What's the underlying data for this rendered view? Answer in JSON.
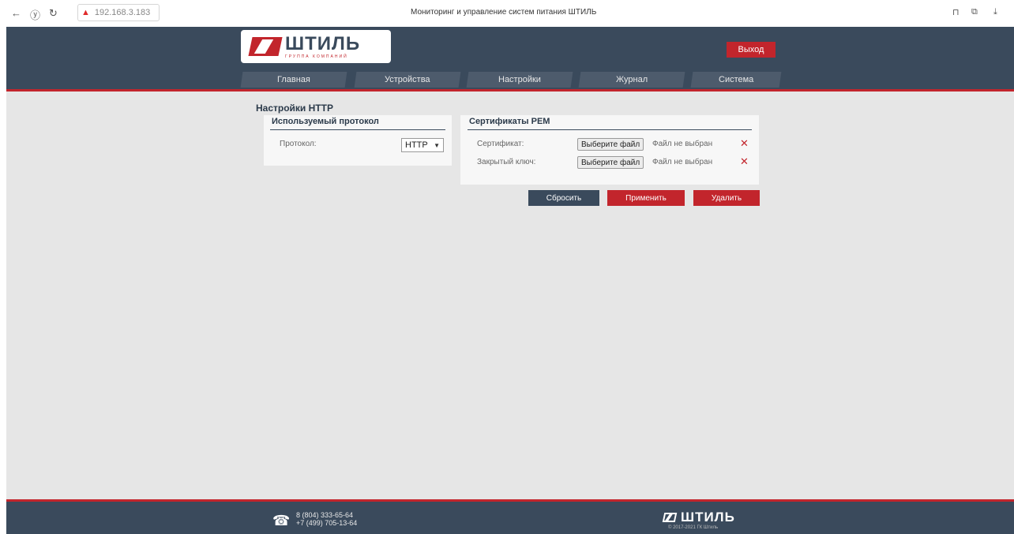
{
  "browser": {
    "url": "192.168.3.183",
    "tab_title": "Мониторинг и управление систем питания ШТИЛЬ"
  },
  "header": {
    "logo_name": "ШТИЛЬ",
    "logo_sub": "ГРУППА КОМПАНИЙ",
    "logout_label": "Выход",
    "nav": [
      "Главная",
      "Устройства",
      "Настройки",
      "Журнал",
      "Система"
    ]
  },
  "page": {
    "title": "Настройки HTTP"
  },
  "protocol_panel": {
    "title": "Используемый протокол",
    "protocol_label": "Протокол:",
    "protocol_value": "HTTP"
  },
  "pem_panel": {
    "title": "Сертификаты PEM",
    "cert_label": "Сертификат:",
    "key_label": "Закрытый ключ:",
    "choose_file_label": "Выберите файл",
    "no_file_label": "Файл не выбран"
  },
  "actions": {
    "reset": "Сбросить",
    "apply": "Применить",
    "delete": "Удалить"
  },
  "footer": {
    "phone1": "8 (804) 333-65-64",
    "phone2": "+7 (499) 705-13-64",
    "logo_name": "ШТИЛЬ",
    "copyright": "© 2017-2021 ГК Штиль"
  },
  "colors": {
    "header_bg": "#3a4a5c",
    "accent_red": "#c2252c",
    "content_bg": "#e6e6e6"
  }
}
